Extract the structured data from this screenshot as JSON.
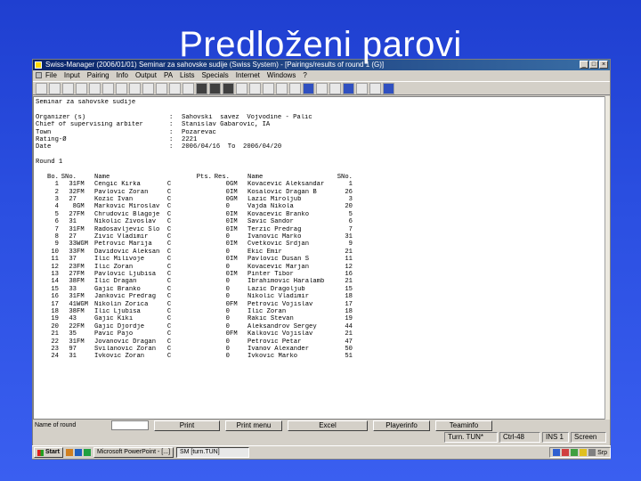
{
  "slide": {
    "title": "Predloženi parovi"
  },
  "window": {
    "title": "Swiss-Manager (2006/01/01)  Seminar za sahovske sudije   (Swiss System) - [Pairings/results of round 1 (G)]",
    "min": "_",
    "max": "□",
    "close": "×"
  },
  "menu": [
    "File",
    "Input",
    "Pairing",
    "Info",
    "Output",
    "PA",
    "Lists",
    "Specials",
    "Internet",
    "Windows",
    "?"
  ],
  "header_lines": [
    {
      "key": "Seminar za sahovske sudije",
      "sep": "",
      "value": ""
    },
    {
      "key": "",
      "sep": "",
      "value": ""
    },
    {
      "key": "Organizer (s)",
      "sep": ":",
      "value": "Sahovski  savez  Vojvodine - Palic"
    },
    {
      "key": "Chief of supervising arbiter",
      "sep": ":",
      "value": "Stanislav Gabarovic, IA"
    },
    {
      "key": "Town",
      "sep": ":",
      "value": "Pozarevac"
    },
    {
      "key": "Rating-Ø",
      "sep": ":",
      "value": "2221"
    },
    {
      "key": "Date",
      "sep": ":",
      "value": "2006/04/16  To  2006/04/20"
    }
  ],
  "round_label": "Round 1",
  "table_header": [
    "Bo.",
    "SNo.",
    "",
    "Name",
    "",
    "Pts.",
    "Res.",
    "",
    "Name",
    "SNo."
  ],
  "rows": [
    [
      "1",
      "31",
      "FM",
      "Cengic Kirka",
      "C",
      "0",
      "GM",
      "Kovacevic Aleksandar",
      "1"
    ],
    [
      "2",
      "32",
      "FM",
      "Pavlovic Zoran",
      "C",
      "0",
      "IM",
      "Kosalovic Dragan B",
      "26"
    ],
    [
      "3",
      "27",
      "",
      "Kozic Ivan",
      "C",
      "0",
      "GM",
      "Lazic Miroljub",
      "3"
    ],
    [
      "4",
      "8",
      "GM",
      "Markovic Miroslav",
      "C",
      "0",
      "",
      "Vajda Nikola",
      "20"
    ],
    [
      "5",
      "27",
      "FM",
      "Chrudovic Blagoje",
      "C",
      "0",
      "IM",
      "Kovacevic Branko",
      "5"
    ],
    [
      "6",
      "31",
      "",
      "Nikolic Zivoslav",
      "C",
      "0",
      "IM",
      "Savic Sandor",
      "6"
    ],
    [
      "7",
      "31",
      "FM",
      "Radosavljevic Slobodan",
      "C",
      "0",
      "IM",
      "Terzic Predrag",
      "7"
    ],
    [
      "8",
      "27",
      "",
      "Zivic Vladimir",
      "C",
      "0",
      "",
      "Ivanovic Marko",
      "31"
    ],
    [
      "9",
      "33",
      "WGM",
      "Petrovic Marija",
      "C",
      "0",
      "IM",
      "Cvetkovic Srdjan",
      "9"
    ],
    [
      "10",
      "33",
      "FM",
      "Davidovic Aleksandar",
      "C",
      "0",
      "",
      "Ekic Emir",
      "21"
    ],
    [
      "11",
      "37",
      "",
      "Ilic Milivoje",
      "C",
      "0",
      "IM",
      "Pavlovic Dusan S",
      "11"
    ],
    [
      "12",
      "23",
      "FM",
      "Ilic Zoran",
      "C",
      "0",
      "",
      "Kovacevic Marjan",
      "12"
    ],
    [
      "13",
      "27",
      "FM",
      "Pavlovic Ljubisa",
      "C",
      "0",
      "IM",
      "Pinter Tibor",
      "16"
    ],
    [
      "14",
      "38",
      "FM",
      "Ilic Dragan",
      "C",
      "0",
      "",
      "Ibrahimovic Haralamb",
      "21"
    ],
    [
      "15",
      "33",
      "",
      "Gajic Branko",
      "C",
      "0",
      "",
      "Lazic Dragoljub",
      "15"
    ],
    [
      "16",
      "31",
      "FM",
      "Jankovic Predrag",
      "C",
      "0",
      "",
      "Nikolic Vladimir",
      "18"
    ],
    [
      "17",
      "41",
      "WGM",
      "Nikolin Zorica",
      "C",
      "0",
      "FM",
      "Petrovic Vojislav",
      "17"
    ],
    [
      "18",
      "38",
      "FM",
      "Ilic Ljubisa",
      "C",
      "0",
      "",
      "Ilic Zoran",
      "18"
    ],
    [
      "19",
      "43",
      "",
      "Gajic Kiki",
      "C",
      "0",
      "",
      "Rakic Stevan",
      "19"
    ],
    [
      "20",
      "22",
      "FM",
      "Gajic Djordje",
      "C",
      "0",
      "",
      "Aleksandrov Sergey",
      "44"
    ],
    [
      "21",
      "35",
      "",
      "Pavic Pajo",
      "C",
      "0",
      "FM",
      "Kalkovic Vojislav",
      "21"
    ],
    [
      "22",
      "31",
      "FM",
      "Jovanovic Dragan",
      "C",
      "0",
      "",
      "Petrovic Petar",
      "47"
    ],
    [
      "23",
      "97",
      "",
      "Svilanovic Zoran",
      "C",
      "0",
      "",
      "Ivanov Alexander",
      "50"
    ],
    [
      "24",
      "31",
      "",
      "Ivkovic Zoran",
      "C",
      "0",
      "",
      "Ivkovic Marko",
      "51"
    ]
  ],
  "bottom": {
    "label": "Name of round",
    "buttons": [
      "Print",
      "Print menu",
      "Excel",
      "Playerinfo",
      "Teaminfo"
    ]
  },
  "status": [
    "Turn. TUN*",
    "Ctrl-48",
    "INS 1",
    "Screen"
  ],
  "taskbar": {
    "start": "Start",
    "tasks": [
      "Microsoft PowerPoint - [...]",
      "SM [turn.TUN]"
    ],
    "clock": "Srp"
  }
}
